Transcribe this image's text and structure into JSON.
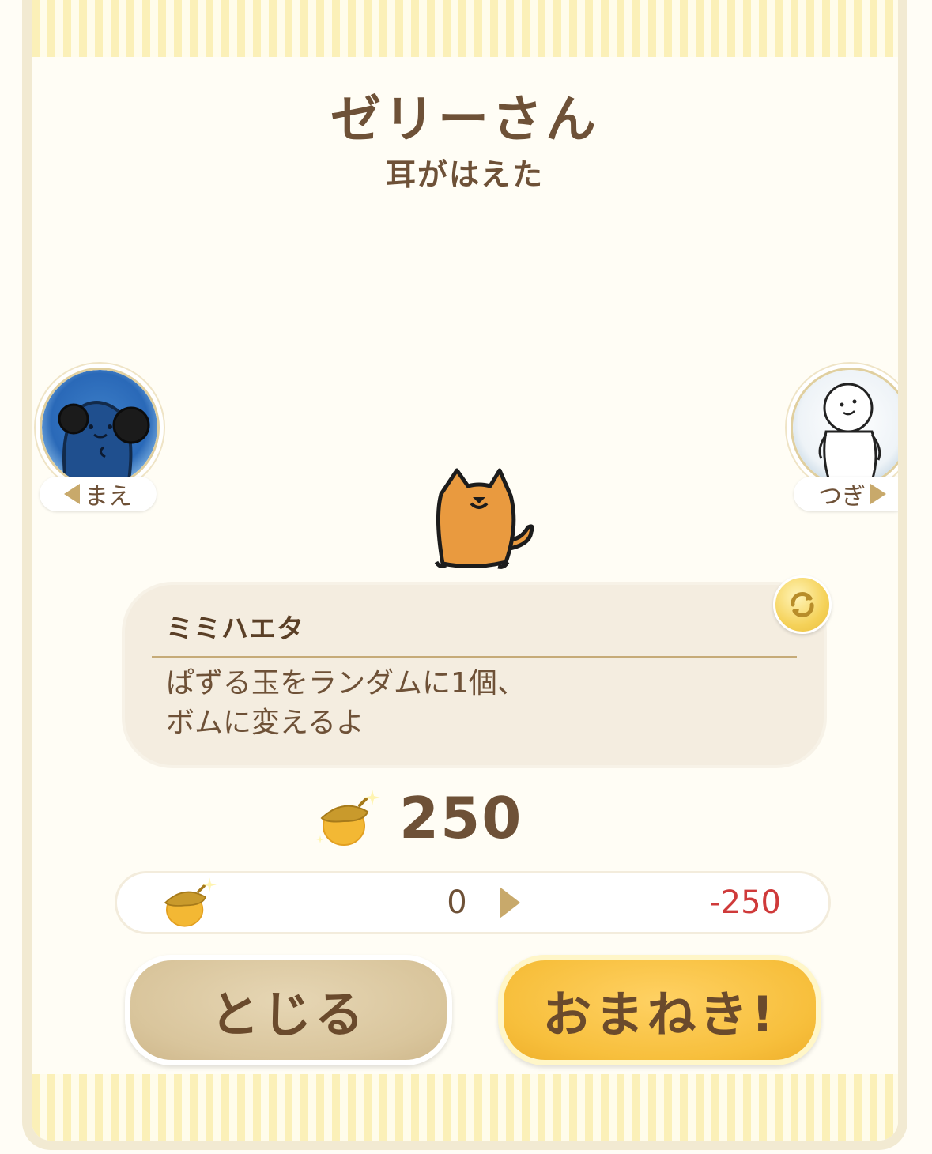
{
  "character": {
    "name": "ゼリーさん",
    "subtitle": "耳がはえた"
  },
  "navigation": {
    "prev_label": "まえ",
    "next_label": "つぎ"
  },
  "skill": {
    "name": "ミミハエタ",
    "description_line1": "ぱずる玉をランダムに1個、",
    "description_line2": "ボムに変えるよ"
  },
  "cost": {
    "value": "250"
  },
  "balance": {
    "current": "0",
    "after": "-250"
  },
  "buttons": {
    "close_label": "とじる",
    "beckon_label": "おまねき!"
  },
  "icons": {
    "cost": "acorn-icon",
    "balance": "acorn-icon",
    "refresh": "refresh-icon",
    "prev": "triangle-left-icon",
    "next": "triangle-right-icon"
  },
  "colors": {
    "text_brown": "#6e5137",
    "negative_red": "#cf3a3a",
    "close_button": "#d9c59c",
    "beckon_button": "#f7bf3c"
  }
}
